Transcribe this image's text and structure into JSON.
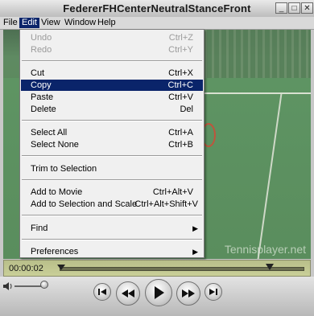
{
  "window": {
    "title": "FedererFHCenterNeutralStanceFront",
    "minimize_glyph": "_",
    "maximize_glyph": "□",
    "close_glyph": "✕"
  },
  "menubar": {
    "items": [
      "File",
      "Edit",
      "View",
      "Window",
      "Help"
    ],
    "active": "Edit"
  },
  "edit_menu": {
    "items": [
      {
        "label": "Undo",
        "shortcut": "Ctrl+Z",
        "enabled": false
      },
      {
        "label": "Redo",
        "shortcut": "Ctrl+Y",
        "enabled": false
      },
      {
        "label": "Cut",
        "shortcut": "Ctrl+X",
        "enabled": true
      },
      {
        "label": "Copy",
        "shortcut": "Ctrl+C",
        "enabled": true,
        "highlighted": true
      },
      {
        "label": "Paste",
        "shortcut": "Ctrl+V",
        "enabled": true
      },
      {
        "label": "Delete",
        "shortcut": "Del",
        "enabled": true
      },
      {
        "label": "Select All",
        "shortcut": "Ctrl+A",
        "enabled": true
      },
      {
        "label": "Select None",
        "shortcut": "Ctrl+B",
        "enabled": true
      },
      {
        "label": "Trim to Selection",
        "shortcut": "",
        "enabled": true
      },
      {
        "label": "Add to Movie",
        "shortcut": "Ctrl+Alt+V",
        "enabled": true
      },
      {
        "label": "Add to Selection and Scale",
        "shortcut": "Ctrl+Alt+Shift+V",
        "enabled": true
      },
      {
        "label": "Find",
        "shortcut": "",
        "submenu": true
      },
      {
        "label": "Preferences",
        "shortcut": "",
        "submenu": true
      }
    ]
  },
  "video": {
    "watermark": "Tennisplayer.net"
  },
  "timeline": {
    "current_time": "00:00:02"
  },
  "controls": {
    "volume_level": 0.85,
    "buttons": [
      "go-to-start",
      "rewind",
      "play",
      "fast-forward",
      "go-to-end"
    ]
  },
  "colors": {
    "highlight": "#0a246a",
    "timebar": "#c2c890",
    "disabled_text": "#9b9b9b"
  }
}
